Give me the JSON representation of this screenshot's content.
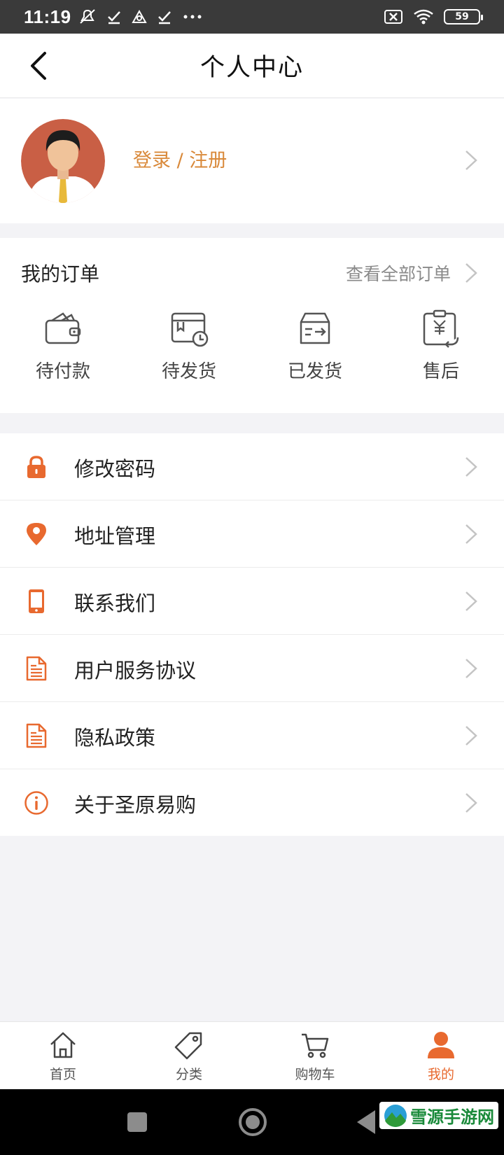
{
  "status_bar": {
    "time": "11:19",
    "battery": "59"
  },
  "header": {
    "title": "个人中心"
  },
  "profile": {
    "login_label": "登录 / 注册"
  },
  "orders": {
    "title": "我的订单",
    "view_all": "查看全部订单",
    "items": [
      {
        "label": "待付款",
        "icon": "wallet-icon"
      },
      {
        "label": "待发货",
        "icon": "pending-ship-icon"
      },
      {
        "label": "已发货",
        "icon": "shipped-box-icon"
      },
      {
        "label": "售后",
        "icon": "after-sale-icon"
      }
    ]
  },
  "menu": {
    "items": [
      {
        "label": "修改密码",
        "icon": "lock-icon"
      },
      {
        "label": "地址管理",
        "icon": "location-pin-icon"
      },
      {
        "label": "联系我们",
        "icon": "phone-icon"
      },
      {
        "label": "用户服务协议",
        "icon": "document-icon"
      },
      {
        "label": "隐私政策",
        "icon": "document-icon"
      },
      {
        "label": "关于圣原易购",
        "icon": "info-icon"
      }
    ]
  },
  "tabbar": {
    "items": [
      {
        "label": "首页",
        "icon": "home-icon",
        "active": false
      },
      {
        "label": "分类",
        "icon": "tag-icon",
        "active": false
      },
      {
        "label": "购物车",
        "icon": "cart-icon",
        "active": false
      },
      {
        "label": "我的",
        "icon": "user-icon",
        "active": true
      }
    ]
  },
  "watermark": {
    "text": "雪源手游网"
  },
  "colors": {
    "accent": "#e8692f",
    "login_text": "#d9893a",
    "background": "#f3f3f6"
  }
}
